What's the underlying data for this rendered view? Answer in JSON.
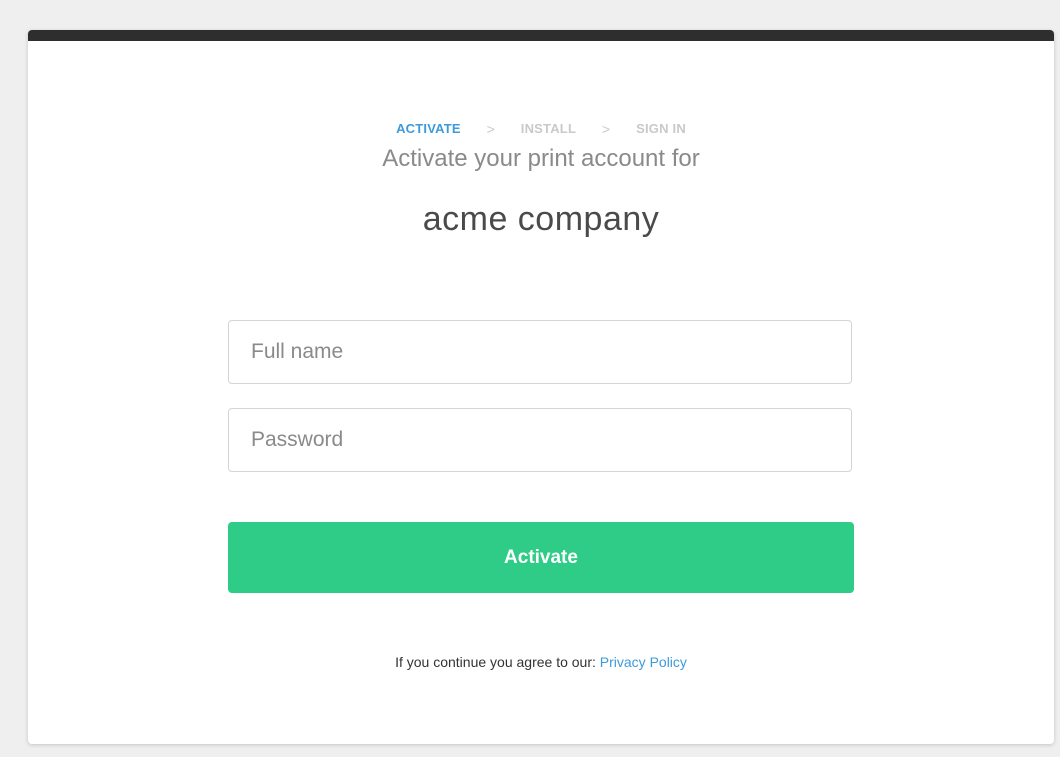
{
  "steps": {
    "items": [
      "ACTIVATE",
      "INSTALL",
      "SIGN IN"
    ],
    "separator": ">"
  },
  "header": {
    "subtitle": "Activate your print account for",
    "company_name": "acme company"
  },
  "form": {
    "full_name": {
      "value": "",
      "placeholder": "Full name"
    },
    "password": {
      "value": "",
      "placeholder": "Password"
    },
    "submit_label": "Activate"
  },
  "legal": {
    "prefix": "If you continue you agree to our:",
    "link_text": "Privacy Policy"
  },
  "colors": {
    "accent": "#3d9bdc",
    "button": "#2ecc87",
    "topbar": "#2e2e2e"
  }
}
